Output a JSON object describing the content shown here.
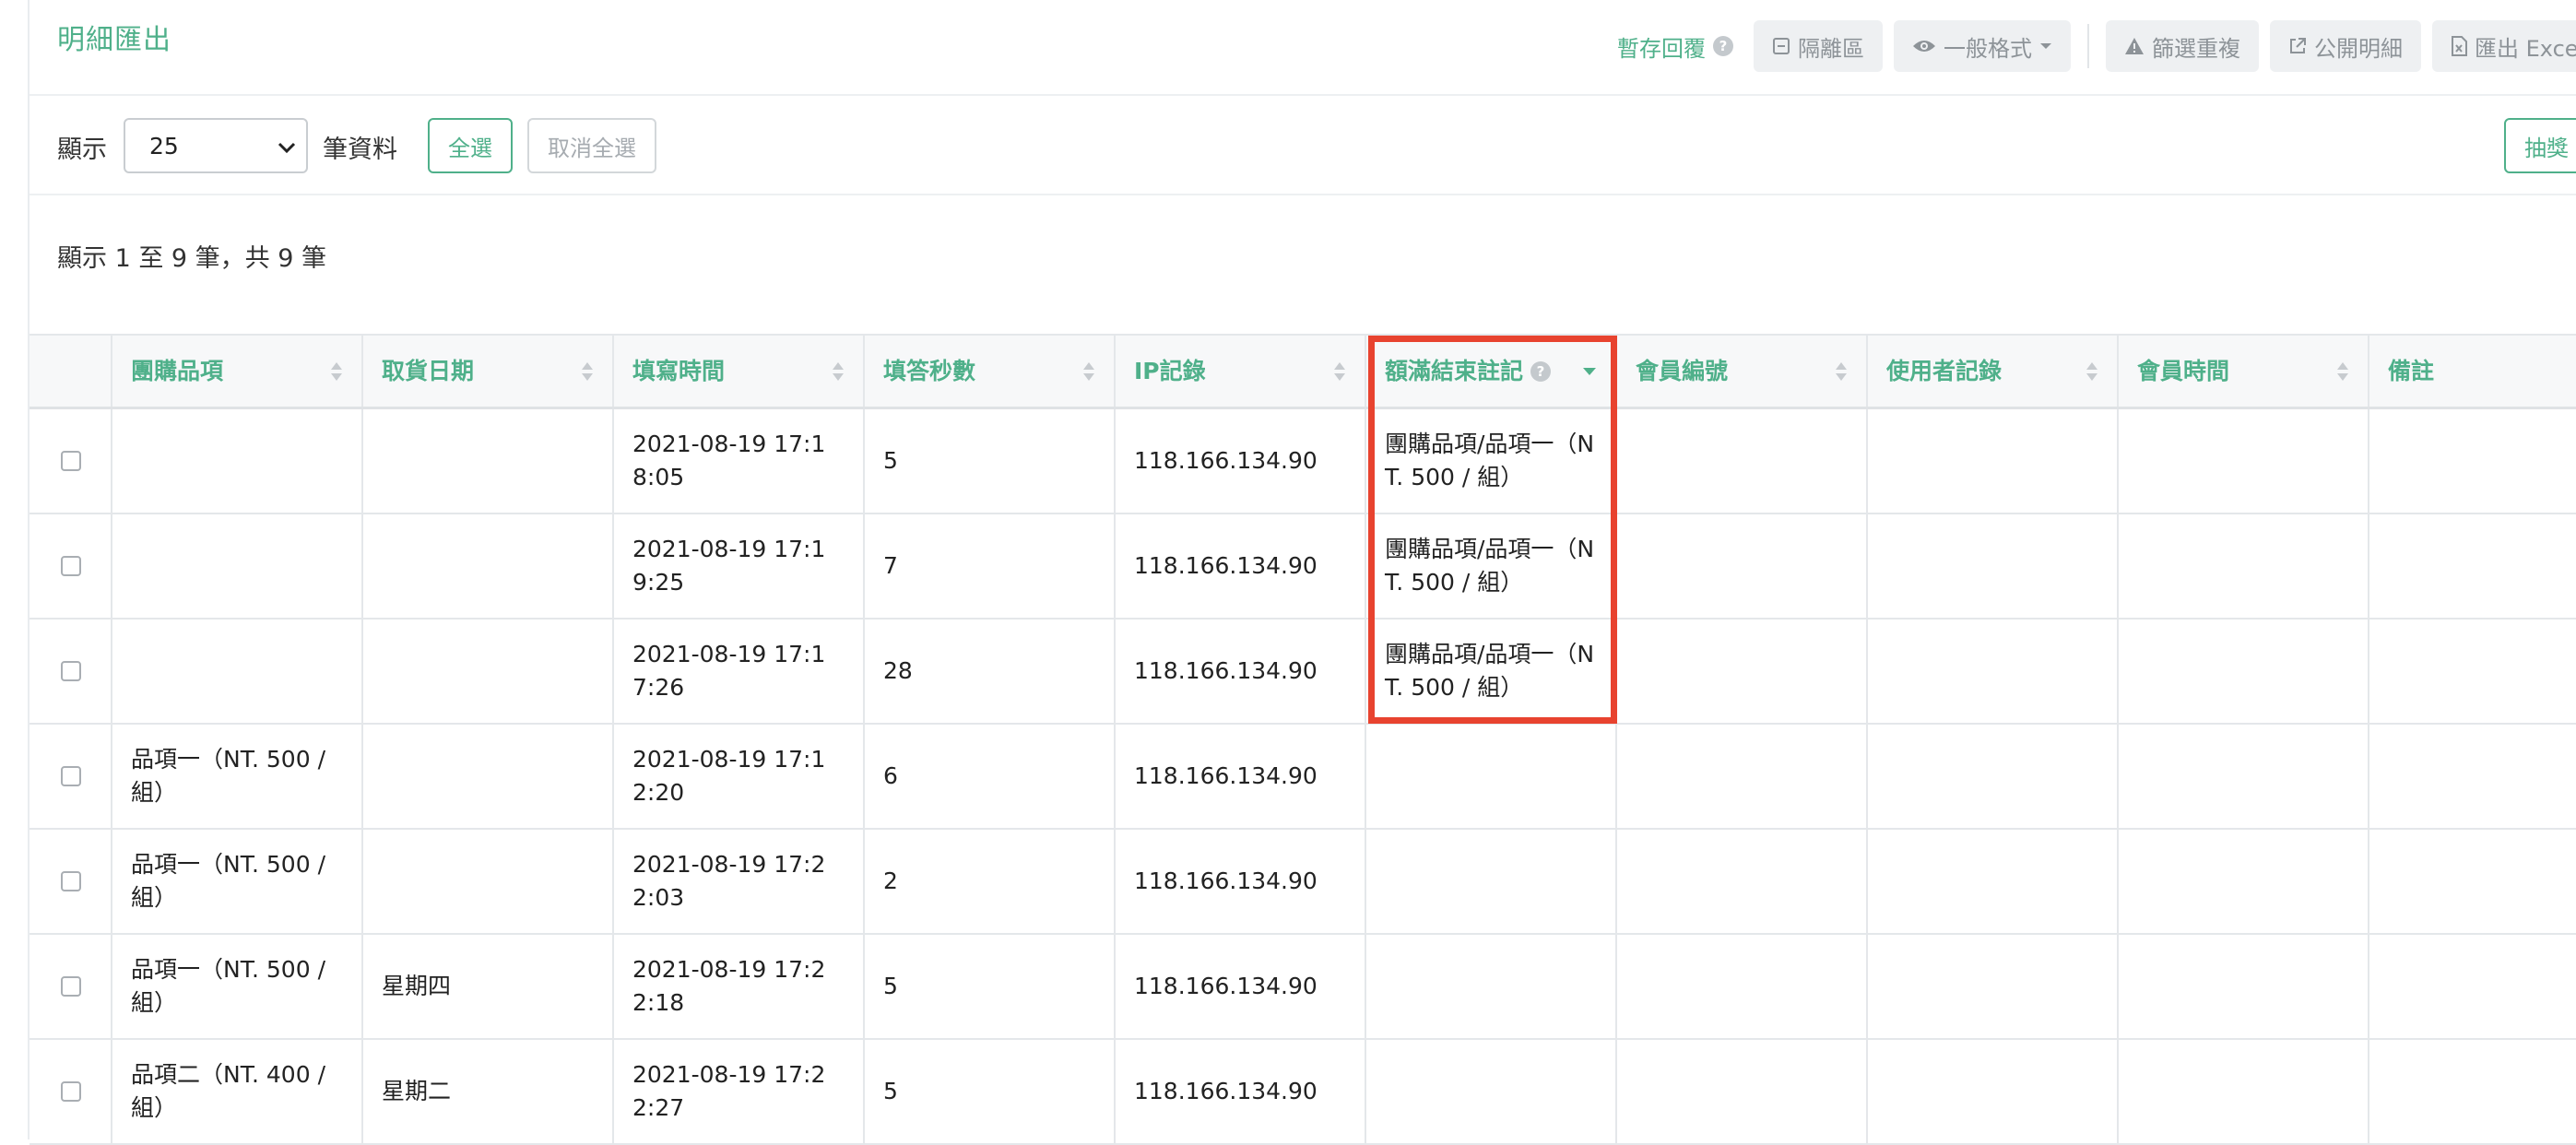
{
  "header": {
    "title": "明細匯出",
    "temp_reply": "暫存回覆",
    "buttons": {
      "isolation": "隔離區",
      "format": "一般格式",
      "filter_dup": "篩選重複",
      "public_detail": "公開明細",
      "export_excel": "匯出 Excel"
    }
  },
  "controls": {
    "show_label": "顯示",
    "page_size": "25",
    "records_label": "筆資料",
    "select_all": "全選",
    "deselect_all": "取消全選",
    "lottery": "抽獎"
  },
  "summary": "顯示 1 至 9 筆，共 9 筆",
  "table": {
    "columns": [
      "團購品項",
      "取貨日期",
      "填寫時間",
      "填答秒數",
      "IP記錄",
      "額滿結束註記",
      "會員編號",
      "使用者記錄",
      "會員時間",
      "備註"
    ],
    "rows": [
      {
        "item": "",
        "pickup": "",
        "time": "2021-08-19 17:18:05",
        "secs": "5",
        "ip": "118.166.134.90",
        "full": "團購品項/品項一（NT. 500 / 組）"
      },
      {
        "item": "",
        "pickup": "",
        "time": "2021-08-19 17:19:25",
        "secs": "7",
        "ip": "118.166.134.90",
        "full": "團購品項/品項一（NT. 500 / 組）"
      },
      {
        "item": "",
        "pickup": "",
        "time": "2021-08-19 17:17:26",
        "secs": "28",
        "ip": "118.166.134.90",
        "full": "團購品項/品項一（NT. 500 / 組）"
      },
      {
        "item": "品項一（NT. 500 / 組）",
        "pickup": "",
        "time": "2021-08-19 17:12:20",
        "secs": "6",
        "ip": "118.166.134.90",
        "full": ""
      },
      {
        "item": "品項一（NT. 500 / 組）",
        "pickup": "",
        "time": "2021-08-19 17:22:03",
        "secs": "2",
        "ip": "118.166.134.90",
        "full": ""
      },
      {
        "item": "品項一（NT. 500 / 組）",
        "pickup": "星期四",
        "time": "2021-08-19 17:22:18",
        "secs": "5",
        "ip": "118.166.134.90",
        "full": ""
      },
      {
        "item": "品項二（NT. 400 / 組）",
        "pickup": "星期二",
        "time": "2021-08-19 17:22:27",
        "secs": "5",
        "ip": "118.166.134.90",
        "full": ""
      }
    ]
  },
  "colors": {
    "accent": "#4fb08a",
    "highlight": "#e8432f"
  }
}
